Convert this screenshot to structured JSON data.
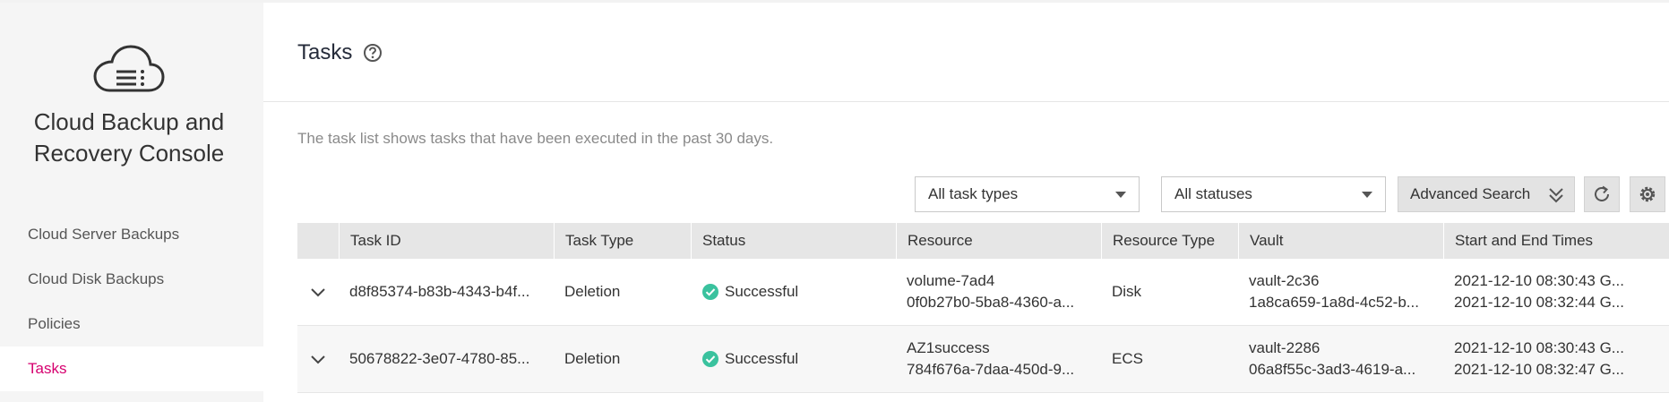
{
  "sidebar": {
    "console_title_line1": "Cloud Backup and",
    "console_title_line2": "Recovery Console",
    "logo_icon": "cloud-list-icon",
    "items": [
      {
        "label": "Cloud Server Backups"
      },
      {
        "label": "Cloud Disk Backups"
      },
      {
        "label": "Policies"
      },
      {
        "label": "Tasks",
        "active": true
      }
    ]
  },
  "header": {
    "title": "Tasks",
    "help_icon": "question-circle-icon",
    "description": "The task list shows tasks that have been executed in the past 30 days."
  },
  "toolbar": {
    "task_type_filter": "All task types",
    "status_filter": "All statuses",
    "advanced_search_label": "Advanced Search",
    "refresh_icon": "refresh-icon",
    "settings_icon": "settings-icon"
  },
  "table": {
    "columns": [
      "Task ID",
      "Task Type",
      "Status",
      "Resource",
      "Resource Type",
      "Vault",
      "Start and End Times"
    ],
    "rows": [
      {
        "task_id": "d8f85374-b83b-4343-b4f...",
        "task_type": "Deletion",
        "status": "Successful",
        "resource_name": "volume-7ad4",
        "resource_id": "0f0b27b0-5ba8-4360-a...",
        "resource_type": "Disk",
        "vault_name": "vault-2c36",
        "vault_id": "1a8ca659-1a8d-4c52-b...",
        "start_time": "2021-12-10 08:30:43 G...",
        "end_time": "2021-12-10 08:32:44 G..."
      },
      {
        "task_id": "50678822-3e07-4780-85...",
        "task_type": "Deletion",
        "status": "Successful",
        "resource_name": "AZ1success",
        "resource_id": "784f676a-7daa-450d-9...",
        "resource_type": "ECS",
        "vault_name": "vault-2286",
        "vault_id": "06a8f55c-3ad3-4619-a...",
        "start_time": "2021-12-10 08:30:43 G...",
        "end_time": "2021-12-10 08:32:47 G..."
      }
    ]
  },
  "colors": {
    "accent": "#d6006f",
    "success": "#3ac29e",
    "sidebar_bg": "#f5f5f5",
    "header_bg": "#e6e6e6"
  }
}
